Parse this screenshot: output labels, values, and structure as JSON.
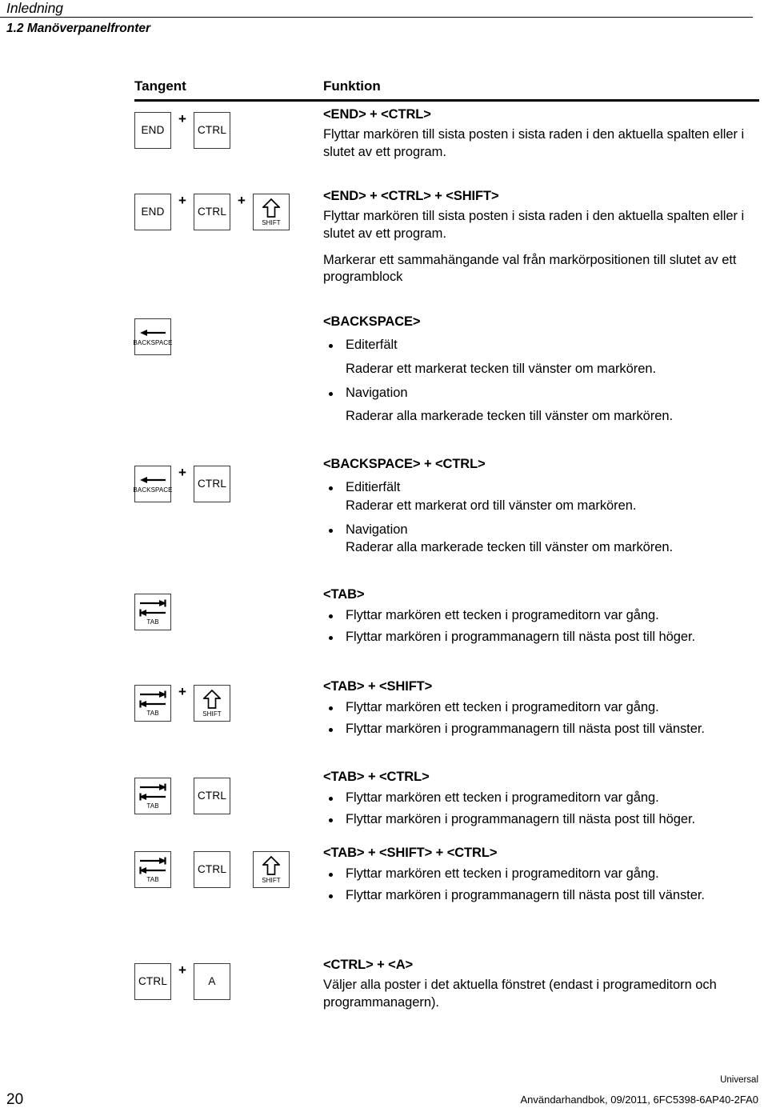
{
  "header": {
    "chapter": "Inledning",
    "section": "1.2 Manöverpanelfronter"
  },
  "table": {
    "col_key_header": "Tangent",
    "col_func_header": "Funktion"
  },
  "rows": [
    {
      "keys": [
        {
          "icon": "key-end",
          "label": "END"
        },
        {
          "sep": "+"
        },
        {
          "icon": "key-ctrl",
          "label": "CTRL"
        }
      ],
      "title": "<END> + <CTRL>",
      "paras": [
        "Flyttar markören till sista posten i sista raden i den aktuella spalten eller i slutet av ett program."
      ]
    },
    {
      "keys": [
        {
          "icon": "key-end",
          "label": "END"
        },
        {
          "sep": "+"
        },
        {
          "icon": "key-ctrl",
          "label": "CTRL"
        },
        {
          "sep": "+"
        },
        {
          "icon": "key-shift",
          "label": "SHIFT"
        }
      ],
      "title": "<END> + <CTRL> + <SHIFT>",
      "paras": [
        "Flyttar markören till sista posten i sista raden i den aktuella spalten eller i slutet av ett program.",
        "Markerar ett sammahängande val från markörpositionen till slutet av ett programblock"
      ]
    },
    {
      "keys": [
        {
          "icon": "key-backspace",
          "label": "BACKSPACE"
        }
      ],
      "title": "<BACKSPACE>",
      "bullets": [
        {
          "bullet": "Editerfält",
          "sub": "Raderar ett markerat tecken till vänster om markören."
        },
        {
          "bullet": "Navigation",
          "sub": "Raderar alla markerade tecken till vänster om markören."
        }
      ]
    },
    {
      "keys": [
        {
          "icon": "key-backspace",
          "label": "BACKSPACE"
        },
        {
          "sep": "+"
        },
        {
          "icon": "key-ctrl",
          "label": "CTRL"
        }
      ],
      "title": "<BACKSPACE> + <CTRL>",
      "bullets": [
        {
          "bullet": "Editierfält",
          "sub": "Raderar ett markerat ord till vänster om markören."
        },
        {
          "bullet": "Navigation",
          "sub": "Raderar alla markerade tecken till vänster om markören."
        }
      ]
    },
    {
      "keys": [
        {
          "icon": "key-tab",
          "label": "TAB"
        }
      ],
      "title": "<TAB>",
      "bullets": [
        {
          "bullet": "Flyttar markören ett tecken i programeditorn var gång."
        },
        {
          "bullet": "Flyttar markören i programmanagern till nästa post till höger."
        }
      ]
    },
    {
      "keys": [
        {
          "icon": "key-tab",
          "label": "TAB"
        },
        {
          "sep": "+"
        },
        {
          "icon": "key-shift",
          "label": "SHIFT"
        }
      ],
      "title": "<TAB> + <SHIFT>",
      "bullets": [
        {
          "bullet": "Flyttar markören ett tecken i programeditorn var gång."
        },
        {
          "bullet": "Flyttar markören i programmanagern till nästa post till vänster."
        }
      ]
    },
    {
      "keys": [
        {
          "icon": "key-tab",
          "label": "TAB"
        },
        {
          "sep": ""
        },
        {
          "icon": "key-ctrl",
          "label": "CTRL"
        }
      ],
      "title": "<TAB> + <CTRL>",
      "bullets": [
        {
          "bullet": "Flyttar markören ett tecken i programeditorn var gång."
        },
        {
          "bullet": "Flyttar markören i programmanagern till nästa post till höger."
        }
      ]
    },
    {
      "keys": [
        {
          "icon": "key-tab",
          "label": "TAB"
        },
        {
          "sep": ""
        },
        {
          "icon": "key-ctrl",
          "label": "CTRL"
        },
        {
          "sep": ""
        },
        {
          "icon": "key-shift",
          "label": "SHIFT"
        }
      ],
      "title": "<TAB> + <SHIFT> + <CTRL>",
      "bullets": [
        {
          "bullet": "Flyttar markören ett tecken i programeditorn var gång."
        },
        {
          "bullet": "Flyttar markören i programmanagern till nästa post till vänster."
        }
      ]
    },
    {
      "keys": [
        {
          "icon": "key-ctrl",
          "label": "CTRL"
        },
        {
          "sep": "+"
        },
        {
          "icon": "key-a",
          "label": "A"
        }
      ],
      "title": "<CTRL> + <A>",
      "paras": [
        "Väljer alla poster i det aktuella fönstret (endast i programeditorn och programmanagern)."
      ]
    }
  ],
  "footer": {
    "universal": "Universal",
    "page_number": "20",
    "document": "Användarhandbok, 09/2011, 6FC5398-6AP40-2FA0"
  }
}
